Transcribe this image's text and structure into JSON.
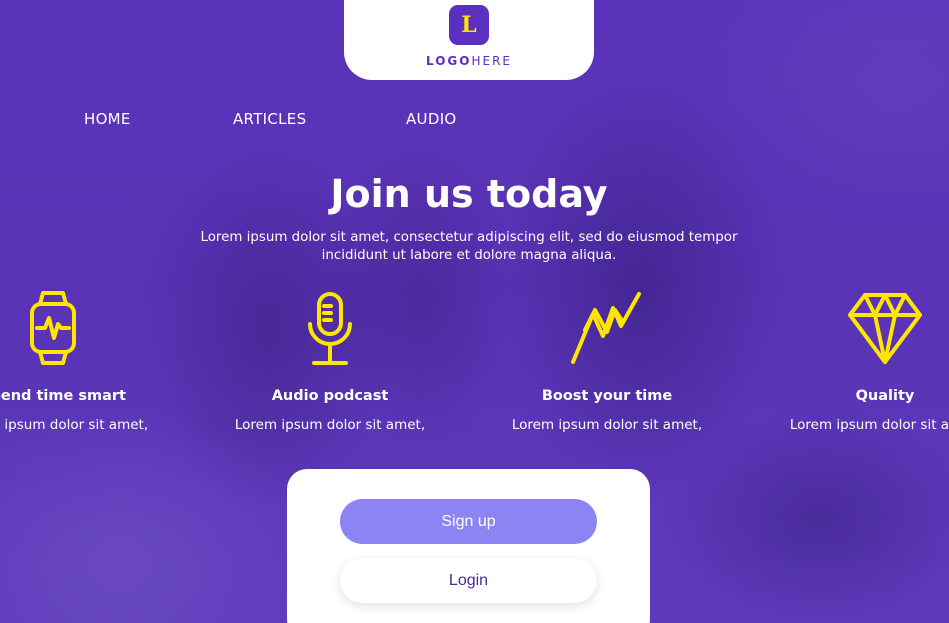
{
  "logo": {
    "letter": "L",
    "text_bold": "LOGO",
    "text_light": "HERE"
  },
  "nav": {
    "items": [
      "HOME",
      "ARTICLES",
      "AUDIO"
    ]
  },
  "hero": {
    "title": "Join us today",
    "subtitle_line1": "Lorem ipsum dolor sit amet, consectetur adipiscing elit, sed do eiusmod tempor",
    "subtitle_line2": "incididunt ut labore et dolore magna aliqua."
  },
  "features": [
    {
      "icon": "smartwatch-icon",
      "title": "Spend time smart",
      "text": "Lorem ipsum dolor sit amet,"
    },
    {
      "icon": "microphone-icon",
      "title": "Audio podcast",
      "text": "Lorem ipsum dolor sit amet,"
    },
    {
      "icon": "zigzag-chart-icon",
      "title": "Boost your time",
      "text": "Lorem ipsum dolor sit amet,"
    },
    {
      "icon": "diamond-icon",
      "title": "Quality",
      "text": "Lorem ipsum dolor sit amet,"
    }
  ],
  "auth": {
    "signup_label": "Sign up",
    "login_label": "Login"
  },
  "colors": {
    "brand_purple": "#5b2fc0",
    "accent_yellow": "#ffe600",
    "signup_button": "#8c84f2",
    "white": "#ffffff"
  }
}
